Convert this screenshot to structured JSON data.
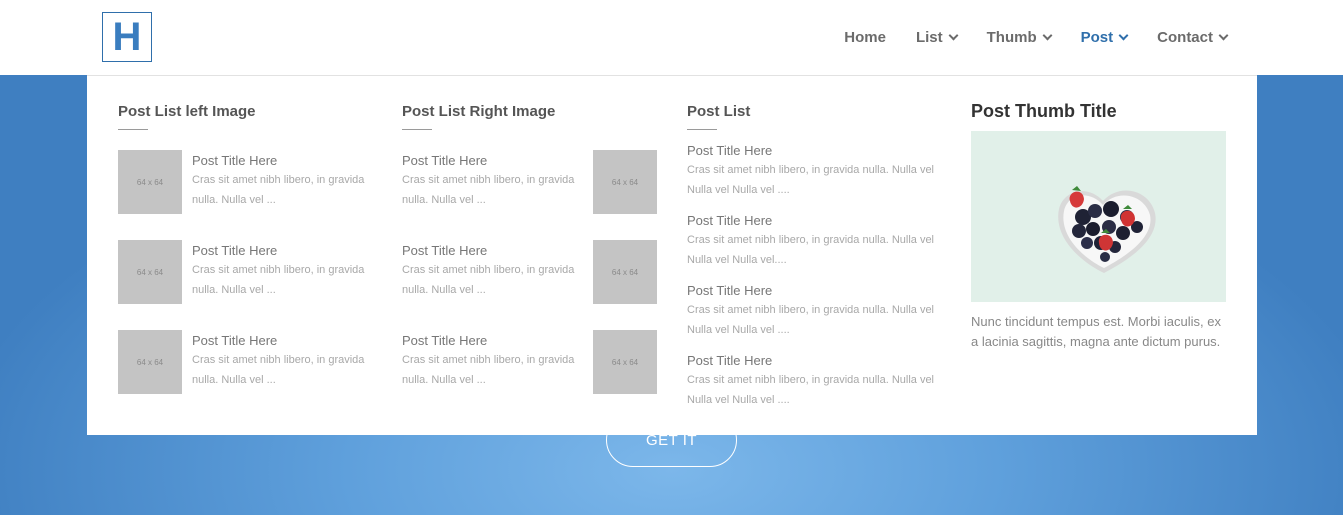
{
  "header": {
    "logo_letter": "H",
    "nav": [
      {
        "label": "Home",
        "has_dropdown": false,
        "active": false
      },
      {
        "label": "List",
        "has_dropdown": true,
        "active": false
      },
      {
        "label": "Thumb",
        "has_dropdown": true,
        "active": false
      },
      {
        "label": "Post",
        "has_dropdown": true,
        "active": true
      },
      {
        "label": "Contact",
        "has_dropdown": true,
        "active": false
      }
    ],
    "active_color": "#2f6fab"
  },
  "hero": {
    "cta_label": "GET IT"
  },
  "mega_menu": {
    "left_image": {
      "title": "Post List left Image",
      "items": [
        {
          "thumb": "64 x 64",
          "title": "Post Title Here",
          "line1": "Cras sit amet nibh libero, in gravida",
          "line2": "nulla. Nulla vel ..."
        },
        {
          "thumb": "64 x 64",
          "title": "Post Title Here",
          "line1": "Cras sit amet nibh libero, in gravida",
          "line2": "nulla. Nulla vel ..."
        },
        {
          "thumb": "64 x 64",
          "title": "Post Title Here",
          "line1": "Cras sit amet nibh libero, in gravida",
          "line2": "nulla. Nulla vel ..."
        }
      ]
    },
    "right_image": {
      "title": "Post List Right Image",
      "items": [
        {
          "thumb": "64 x 64",
          "title": "Post Title Here",
          "line1": "Cras sit amet nibh libero, in gravida",
          "line2": "nulla. Nulla vel ..."
        },
        {
          "thumb": "64 x 64",
          "title": "Post Title Here",
          "line1": "Cras sit amet nibh libero, in gravida",
          "line2": "nulla. Nulla vel ..."
        },
        {
          "thumb": "64 x 64",
          "title": "Post Title Here",
          "line1": "Cras sit amet nibh libero, in gravida",
          "line2": "nulla. Nulla vel ..."
        }
      ]
    },
    "post_list": {
      "title": "Post List",
      "items": [
        {
          "title": "Post Title Here",
          "line1": "Cras sit amet nibh libero, in gravida nulla. Nulla vel",
          "line2": "Nulla vel Nulla vel ...."
        },
        {
          "title": "Post Title Here",
          "line1": "Cras sit amet nibh libero, in gravida nulla. Nulla vel",
          "line2": "Nulla vel Nulla vel...."
        },
        {
          "title": "Post Title Here",
          "line1": "Cras sit amet nibh libero, in gravida nulla. Nulla vel",
          "line2": "Nulla vel Nulla vel ...."
        },
        {
          "title": "Post Title Here",
          "line1": "Cras sit amet nibh libero, in gravida nulla. Nulla vel",
          "line2": "Nulla vel Nulla vel ...."
        }
      ]
    },
    "thumb": {
      "title": "Post Thumb Title",
      "image": "heart-bowl-berries",
      "text": "Nunc tincidunt tempus est. Morbi iaculis, ex a lacinia sagittis, magna ante dictum purus."
    }
  }
}
